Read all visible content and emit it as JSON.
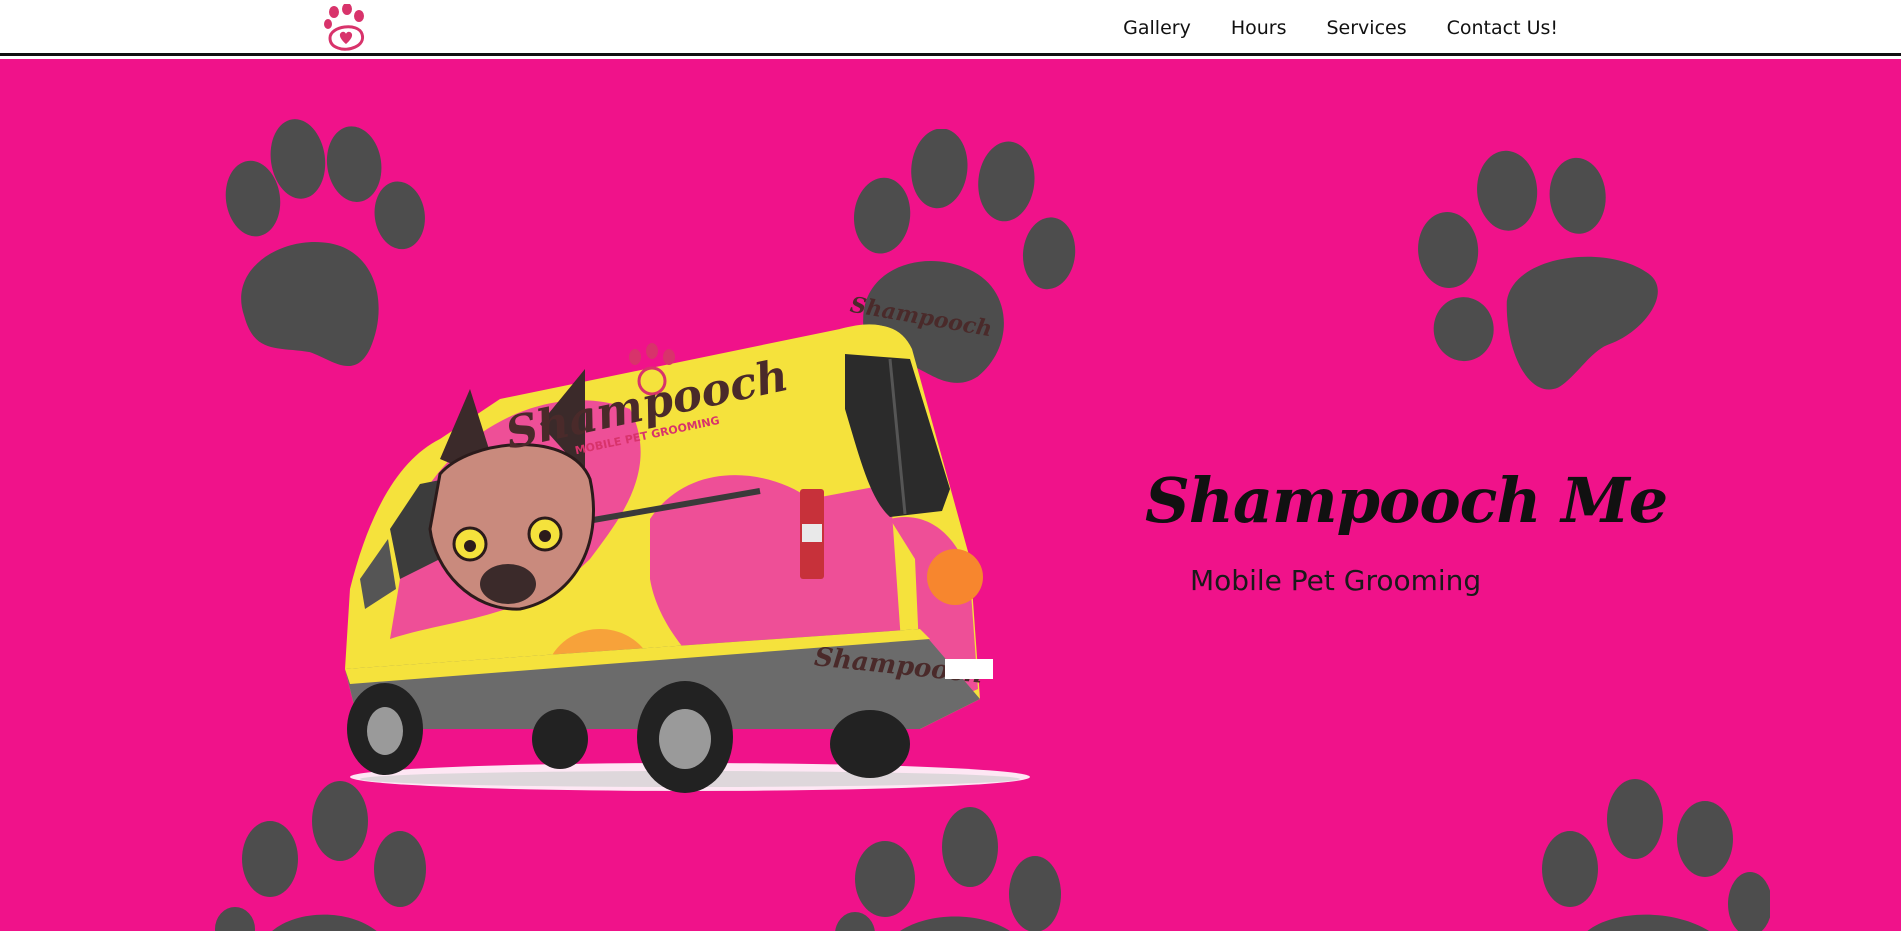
{
  "nav": {
    "logo_icon": "paw-heart-logo-icon",
    "links": [
      "Gallery",
      "Hours",
      "Services",
      "Contact Us!"
    ]
  },
  "hero": {
    "title": "Shampooch Me",
    "subtitle": "Mobile Pet Grooming",
    "van_image": {
      "icon": "grooming-van-illustration",
      "brand_text": "Shampooch",
      "tagline_text": "MOBILE PET GROOMING"
    },
    "background_pattern_icon": "paw-print-icon"
  },
  "colors": {
    "hero_background": "#f0128a",
    "paw_print": "#4d4d4d",
    "van_yellow": "#f5e23c",
    "van_pink": "#ee4f97",
    "brand_pink": "#d8336b"
  }
}
